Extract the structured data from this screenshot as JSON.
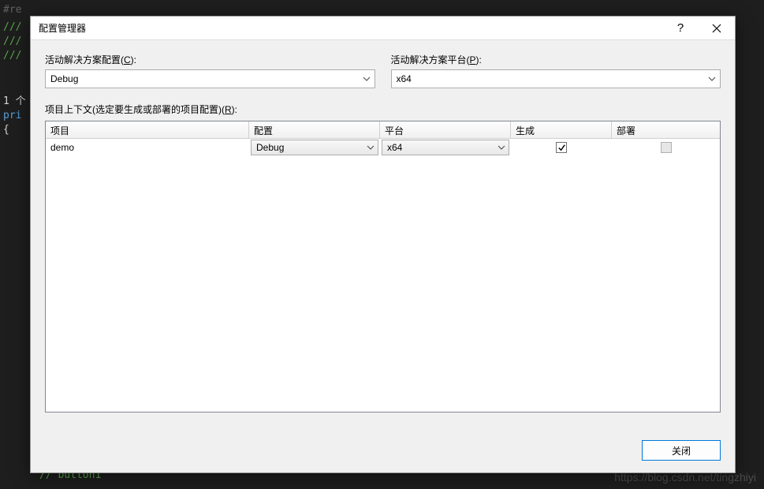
{
  "background": {
    "line1": "#re",
    "line2": "///",
    "line3": "///",
    "line4": "///",
    "line5": "1 个",
    "line6": "pri",
    "line7": "{",
    "line8": "// button1",
    "watermark": "https://blog.csdn.net/tingzhiyi"
  },
  "dialog": {
    "title": "配置管理器",
    "activeConfigLabel": "活动解决方案配置(",
    "activeConfigKey": "C",
    "activeConfigLabelEnd": "):",
    "activeConfigValue": "Debug",
    "activePlatformLabel": "活动解决方案平台(",
    "activePlatformKey": "P",
    "activePlatformLabelEnd": "):",
    "activePlatformValue": "x64",
    "contextLabel": "项目上下文(选定要生成或部署的项目配置)(",
    "contextKey": "R",
    "contextLabelEnd": "):",
    "columns": {
      "project": "项目",
      "config": "配置",
      "platform": "平台",
      "build": "生成",
      "deploy": "部署"
    },
    "rows": [
      {
        "project": "demo",
        "config": "Debug",
        "platform": "x64",
        "build": true,
        "deploy": false,
        "deployEnabled": false
      }
    ],
    "closeButton": "关闭"
  }
}
